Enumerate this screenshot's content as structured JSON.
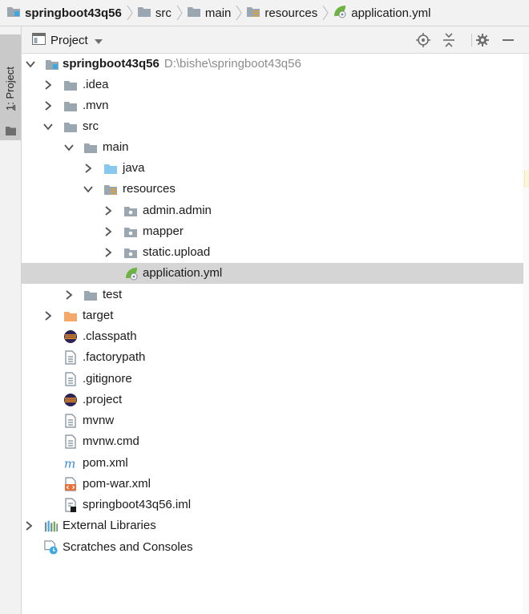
{
  "breadcrumbs": [
    {
      "label": "springboot43q56",
      "icon": "module-folder-icon",
      "bold": true
    },
    {
      "label": "src",
      "icon": "folder-icon",
      "bold": false
    },
    {
      "label": "main",
      "icon": "folder-icon",
      "bold": false
    },
    {
      "label": "resources",
      "icon": "resources-folder-icon",
      "bold": false
    },
    {
      "label": "application.yml",
      "icon": "spring-yml-icon",
      "bold": false
    }
  ],
  "toolstrip": {
    "number": "1",
    "label": ": Project"
  },
  "panel": {
    "title": "Project",
    "buttons": [
      "locate-icon",
      "collapse-all-icon",
      "settings-icon",
      "hide-icon"
    ]
  },
  "tree": {
    "root": {
      "label": "springboot43q56",
      "path": "D:\\bishe\\springboot43q56"
    },
    "items": [
      {
        "label": ".idea"
      },
      {
        "label": ".mvn"
      },
      {
        "label": "src"
      },
      {
        "label": "main"
      },
      {
        "label": "java"
      },
      {
        "label": "resources"
      },
      {
        "label": "admin.admin"
      },
      {
        "label": "mapper"
      },
      {
        "label": "static.upload"
      },
      {
        "label": "application.yml",
        "selected": true
      },
      {
        "label": "test"
      },
      {
        "label": "target"
      },
      {
        "label": ".classpath"
      },
      {
        "label": ".factorypath"
      },
      {
        "label": ".gitignore"
      },
      {
        "label": ".project"
      },
      {
        "label": "mvnw"
      },
      {
        "label": "mvnw.cmd"
      },
      {
        "label": "pom.xml"
      },
      {
        "label": "pom-war.xml"
      },
      {
        "label": "springboot43q56.iml"
      },
      {
        "label": "External Libraries"
      },
      {
        "label": "Scratches and Consoles"
      }
    ]
  },
  "colors": {
    "selection": "#d5d5d5",
    "folder": "#9aa7b0",
    "source_folder": "#87c8ec",
    "excluded_folder": "#f4a86a",
    "module_dot": "#40a8e0",
    "spring_green": "#6db33f",
    "maven_blue": "#3b8ed6"
  }
}
